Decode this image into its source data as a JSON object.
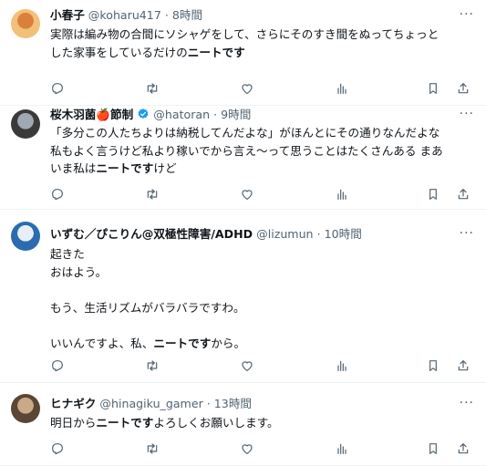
{
  "tweets": [
    {
      "name": "小春子",
      "handle": "@koharu417",
      "sep": "·",
      "time": "8時間",
      "lines": [
        {
          "pre": "実際は編み物の合間にソシャゲをして、さらにそのすき間をぬってちょっと",
          "bold": "",
          "post": ""
        },
        {
          "pre": "した家事をしているだけの",
          "bold": "ニートです",
          "post": ""
        }
      ],
      "avatar_colors": [
        "#f2c078",
        "#d9803d"
      ]
    },
    {
      "name": "桜木羽菌🍎節制",
      "handle": "@hatoran",
      "sep": "·",
      "time": "9時間",
      "lines": [
        {
          "pre": "「多分この人たちよりは納税してんだよな」がほんとにその通りなんだよな",
          "bold": "",
          "post": ""
        },
        {
          "pre": "私もよく言うけど私より稼いでから言え〜って思うことはたくさんある まあ",
          "bold": "",
          "post": ""
        },
        {
          "pre": "いま私は",
          "bold": "ニートです",
          "post": "けど"
        }
      ],
      "avatar_colors": [
        "#3a3a3a",
        "#a0a8b4"
      ]
    },
    {
      "name": "いずむ／ぴこりん@双極性障害/ADHD",
      "handle": "@lizumun",
      "sep": "·",
      "time": "10時間",
      "lines": [
        {
          "pre": "起きた",
          "bold": "",
          "post": ""
        },
        {
          "pre": "おはよう。",
          "bold": "",
          "post": ""
        },
        {
          "pre": "",
          "bold": "",
          "post": ""
        },
        {
          "pre": "もう、生活リズムがバラバラですわ。",
          "bold": "",
          "post": ""
        },
        {
          "pre": "",
          "bold": "",
          "post": ""
        },
        {
          "pre": "いいんですよ、私、",
          "bold": "ニートです",
          "post": "から。"
        }
      ],
      "avatar_colors": [
        "#2b6cb0",
        "#e8eef6"
      ]
    },
    {
      "name": "ヒナギク",
      "handle": "@hinagiku_gamer",
      "sep": "·",
      "time": "13時間",
      "lines": [
        {
          "pre": "明日から",
          "bold": "ニートです",
          "post": "よろしくお願いします。"
        }
      ],
      "avatar_colors": [
        "#5a4634",
        "#c9a986"
      ]
    }
  ],
  "colors": {
    "secondary": "#536471",
    "verified": "#1d9bf0",
    "border": "#eff3f4"
  },
  "icons": [
    "more-icon",
    "reply-icon",
    "retweet-icon",
    "like-icon",
    "views-icon",
    "bookmark-icon",
    "share-icon",
    "verified-icon"
  ]
}
